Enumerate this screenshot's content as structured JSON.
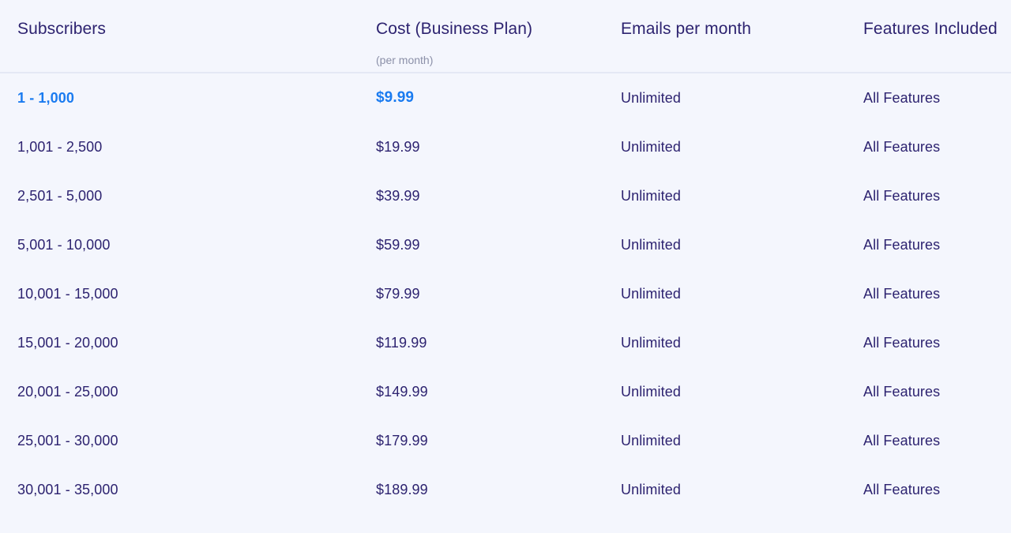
{
  "table": {
    "columns": [
      {
        "key": "subscribers",
        "label": "Subscribers",
        "sublabel": ""
      },
      {
        "key": "cost",
        "label": "Cost (Business Plan)",
        "sublabel": "(per month)"
      },
      {
        "key": "emails",
        "label": "Emails per month",
        "sublabel": ""
      },
      {
        "key": "features",
        "label": "Features Included",
        "sublabel": ""
      }
    ],
    "rows": [
      {
        "subscribers": "1 - 1,000",
        "cost": "$9.99",
        "emails": "Unlimited",
        "features": "All Features",
        "highlighted": true
      },
      {
        "subscribers": "1,001 - 2,500",
        "cost": "$19.99",
        "emails": "Unlimited",
        "features": "All Features",
        "highlighted": false
      },
      {
        "subscribers": "2,501 - 5,000",
        "cost": "$39.99",
        "emails": "Unlimited",
        "features": "All Features",
        "highlighted": false
      },
      {
        "subscribers": "5,001 - 10,000",
        "cost": "$59.99",
        "emails": "Unlimited",
        "features": "All Features",
        "highlighted": false
      },
      {
        "subscribers": "10,001 - 15,000",
        "cost": "$79.99",
        "emails": "Unlimited",
        "features": "All Features",
        "highlighted": false
      },
      {
        "subscribers": "15,001 - 20,000",
        "cost": "$119.99",
        "emails": "Unlimited",
        "features": "All Features",
        "highlighted": false
      },
      {
        "subscribers": "20,001 - 25,000",
        "cost": "$149.99",
        "emails": "Unlimited",
        "features": "All Features",
        "highlighted": false
      },
      {
        "subscribers": "25,001 - 30,000",
        "cost": "$179.99",
        "emails": "Unlimited",
        "features": "All Features",
        "highlighted": false
      },
      {
        "subscribers": "30,001 - 35,000",
        "cost": "$189.99",
        "emails": "Unlimited",
        "features": "All Features",
        "highlighted": false
      }
    ]
  },
  "colors": {
    "background": "#f4f6fd",
    "text_primary": "#2d2370",
    "text_muted": "#8b90a8",
    "accent_highlight": "#1a7bf0",
    "divider": "#e4e8f5"
  }
}
